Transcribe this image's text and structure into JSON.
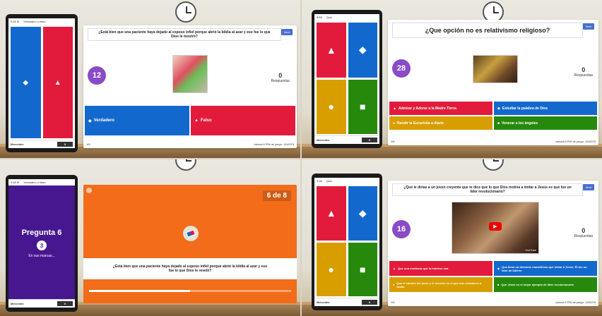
{
  "colors": {
    "red": "#e21b3c",
    "blue": "#1368ce",
    "yellow": "#d89e00",
    "green": "#26890c",
    "purple": "#46178f",
    "orange": "#f26c1a"
  },
  "panel1": {
    "phone": {
      "time": "9:48 ⊕",
      "app_label": "Verdadero o falso"
    },
    "answers": [
      {
        "icon": "◆",
        "color": "#1368ce"
      },
      {
        "icon": "▲",
        "color": "#e21b3c"
      }
    ],
    "footer_name": "Mercedes",
    "footer_score": "0",
    "question": "¿Está bien que una paciente haya dejado al esposo infiel porque abrió la biblia al azar y eso fue lo que Dios le mostró?",
    "next": "Next",
    "timer": "12",
    "answers_count": "0",
    "answers_word": "Respuestas",
    "options": [
      {
        "icon": "◆",
        "label": "Verdadero",
        "color": "#1368ce"
      },
      {
        "icon": "▲",
        "label": "Falso",
        "color": "#e21b3c"
      }
    ],
    "footer_left": "1/5",
    "footer_right": "kahoot.it  PIN de juego: 1110075"
  },
  "panel2": {
    "phone": {
      "time": "9:48",
      "app_label": "Quiz"
    },
    "footer_name": "Mercedes",
    "footer_score": "0",
    "question": "¿Que opción no es relativismo religioso?",
    "next": "Next",
    "timer": "28",
    "answers_count": "0",
    "answers_word": "Respuestas",
    "options": [
      {
        "icon": "▲",
        "label": "Admirar y Adorar a la Madre Tierra",
        "color": "#e21b3c"
      },
      {
        "icon": "◆",
        "label": "Estudiar la palabra de Dios",
        "color": "#1368ce"
      },
      {
        "icon": "●",
        "label": "Rendir la Eucaristía a diario",
        "color": "#d89e00"
      },
      {
        "icon": "■",
        "label": "Venerar a los ángeles",
        "color": "#26890c"
      }
    ],
    "footer_left": "1/5",
    "footer_right": "kahoot.it  PIN de juego: 1110075"
  },
  "panel3": {
    "phone": {
      "time": "9:48 ⊕",
      "app_label": "Verdadero o falso"
    },
    "question_label": "Pregunta 6",
    "question_count": "3",
    "sub": "En sus marcas...",
    "footer_name": "Mercedes",
    "footer_score": "0",
    "counter": "6 de 8",
    "question": "¿Está bien que una paciente haya dejado al esposo infiel porque abrió la biblia al azar y eso fue lo que Dios le reveló?",
    "progress": 0.5
  },
  "panel4": {
    "phone": {
      "time": "9:48",
      "app_label": "Quiz"
    },
    "footer_name": "Mercedes",
    "footer_score": "0",
    "question": "¿Qué le dirías a un joven creyente que te dice que lo que Dios motiva a imitar a Jesús es que fue un líder revolucionario?",
    "next": "Next",
    "timer": "16",
    "answers_count": "0",
    "answers_word": "Respuestas",
    "video_label": "YouTube",
    "options": [
      {
        "icon": "▲",
        "label": "Que una mudanza que la hubiese usa",
        "color": "#e21b3c"
      },
      {
        "icon": "◆",
        "label": "Que tiene un demonio maravilloso que imitar a Jesús. Él fue un líder de líderes",
        "color": "#1368ce"
      },
      {
        "icon": "●",
        "label": "Que el camino del amor y el servicio es el que nos restablece a todos",
        "color": "#d89e00"
      },
      {
        "icon": "■",
        "label": "Que Jesús es el mejor ejemplo de líder revolucionario",
        "color": "#26890c"
      }
    ],
    "footer_left": "1/5",
    "footer_right": "kahoot.it  PIN de juego: 1110075"
  }
}
